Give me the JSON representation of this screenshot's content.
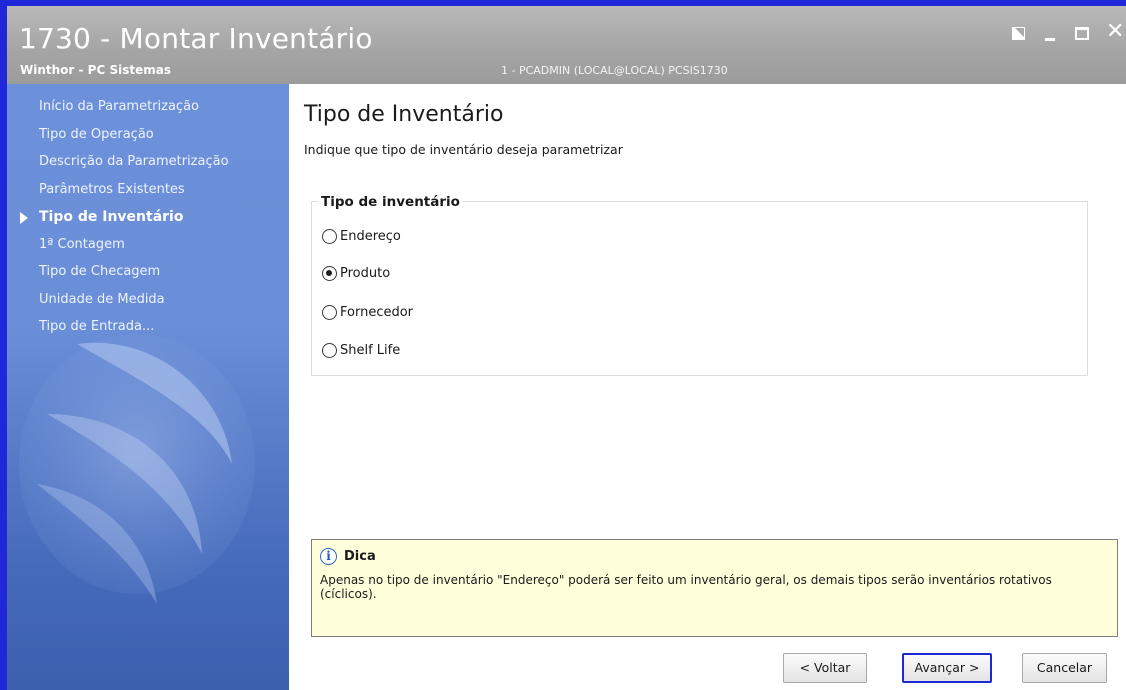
{
  "window": {
    "title": "1730 - Montar Inventário",
    "subtitle": "Winthor - PC Sistemas",
    "session": "1 - PCADMIN (LOCAL@LOCAL)   PCSIS1730",
    "controls": [
      "restore-icon",
      "minimize-icon",
      "maximize-icon",
      "close-icon"
    ],
    "close_glyph": "✕"
  },
  "sidebar": {
    "steps": [
      {
        "label": "Início da Parametrização",
        "active": false
      },
      {
        "label": "Tipo de Operação",
        "active": false
      },
      {
        "label": "Descrição da Parametrização",
        "active": false
      },
      {
        "label": "Parâmetros Existentes",
        "active": false
      },
      {
        "label": "Tipo de Inventário",
        "active": true
      },
      {
        "label": "1ª Contagem",
        "active": false
      },
      {
        "label": "Tipo de Checagem",
        "active": false
      },
      {
        "label": "Unidade de Medida",
        "active": false
      },
      {
        "label": "Tipo de Entrada...",
        "active": false
      }
    ]
  },
  "main": {
    "title": "Tipo de Inventário",
    "description": "Indique que tipo de inventário deseja parametrizar",
    "group": {
      "label": "Tipo de inventário",
      "options": [
        {
          "label": "Endereço",
          "selected": false
        },
        {
          "label": "Produto",
          "selected": true
        },
        {
          "label": "Fornecedor",
          "selected": false
        },
        {
          "label": "Shelf Life",
          "selected": false
        }
      ]
    },
    "tip": {
      "icon": "info-icon",
      "icon_glyph": "i",
      "title": "Dica",
      "text": "Apenas no tipo de inventário \"Endereço\" poderá ser feito um inventário geral, os demais tipos serão inventários rotativos (cíclicos)."
    }
  },
  "buttons": {
    "back": "< Voltar",
    "next": "Avançar >",
    "cancel": "Cancelar"
  },
  "colors": {
    "window_border": "#1f27d8",
    "titlebar": "#a9a9a9",
    "sidebar": "#6a8ed7",
    "tip_background": "#ffffdc",
    "focus_border": "#1a28d6"
  }
}
